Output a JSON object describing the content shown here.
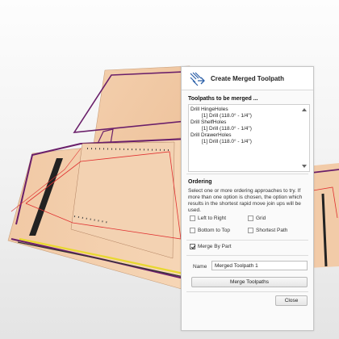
{
  "dialog": {
    "title": "Create Merged Toolpath",
    "icon": "merged-toolpath-icon"
  },
  "toolpaths_section": {
    "title": "Toolpaths to be merged ...",
    "items": [
      {
        "name": "Drill HingeHoles",
        "tool": "[1] Drill (118.0° - 1/4\")"
      },
      {
        "name": "Drill ShelfHoles",
        "tool": "[1] Drill (118.0° - 1/4\")"
      },
      {
        "name": "Drill DrawerHoles",
        "tool": "[1] Drill (118.0° - 1/4\")"
      }
    ]
  },
  "ordering": {
    "title": "Ordering",
    "description": "Select one or more ordering approaches to try. If more than one option is chosen, the option which results in the shortest rapid move join ups will be used.",
    "options": {
      "left_to_right": {
        "label": "Left to Right",
        "checked": false
      },
      "grid": {
        "label": "Grid",
        "checked": false
      },
      "bottom_to_top": {
        "label": "Bottom to Top",
        "checked": false
      },
      "shortest_path": {
        "label": "Shortest Path",
        "checked": false
      }
    },
    "merge_by_part": {
      "label": "Merge By Part",
      "checked": true
    }
  },
  "name_field": {
    "label": "Name",
    "value": "Merged Toolpath 1"
  },
  "buttons": {
    "merge": "Merge Toolpaths",
    "close": "Close"
  },
  "colors": {
    "wood": "#f0c8a4",
    "part_outline": "#6a1f6a",
    "toolpath_red": "#e03030",
    "accent_yellow": "#e8d830"
  }
}
